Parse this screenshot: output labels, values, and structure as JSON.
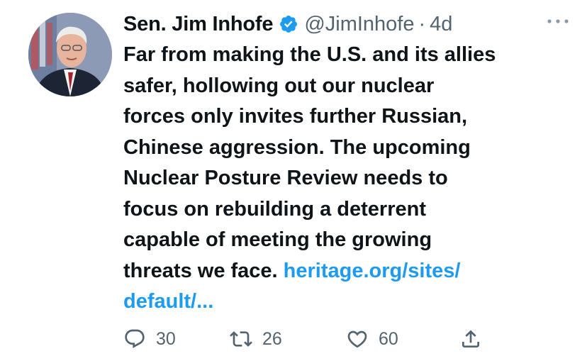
{
  "author": {
    "name": "Sen. Jim Inhofe",
    "handle": "@JimInhofe",
    "separator": "·",
    "time": "4d",
    "verified": true,
    "avatar_description": "headshot-photo"
  },
  "tweet": {
    "text": "Far from making the U.S. and its allies\nsafer, hollowing out our nuclear\nforces only invites further Russian,\nChinese aggression. The upcoming\nNuclear Posture Review needs to\nfocus on rebuilding a deterrent\ncapable of meeting the growing\nthreats we face. ",
    "link_text": "heritage.org/sites/\ndefault/..."
  },
  "actions": {
    "replies": "30",
    "retweets": "26",
    "likes": "60"
  },
  "colors": {
    "text": "#0f1419",
    "secondary": "#536471",
    "link": "#1d9bf0",
    "verified": "#1d9bf0"
  }
}
